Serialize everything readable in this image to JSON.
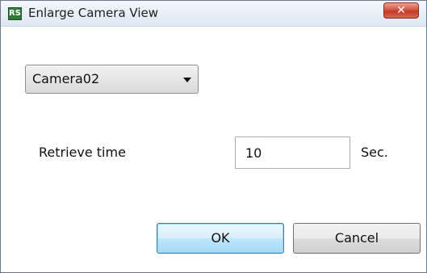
{
  "window": {
    "title": "Enlarge Camera View",
    "app_icon_text": "RS",
    "close_glyph": "✕",
    "icons": {
      "app": "rs-app-icon",
      "close": "close-icon",
      "dropdown": "chevron-down-icon"
    },
    "colors": {
      "close_button": "#c9452f",
      "ok_button_border": "#3c7fb1"
    }
  },
  "camera_select": {
    "value": "Camera02"
  },
  "retrieve": {
    "label": "Retrieve time",
    "value": "10",
    "unit": "Sec."
  },
  "buttons": {
    "ok": "OK",
    "cancel": "Cancel"
  }
}
